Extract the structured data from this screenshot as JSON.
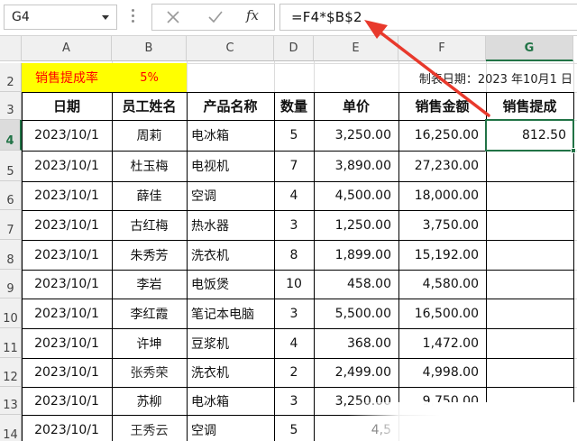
{
  "formula_bar": {
    "name_box": "G4",
    "formula": "=F4*$B$2",
    "fx_label": "fx"
  },
  "columns": [
    "A",
    "B",
    "C",
    "D",
    "E",
    "F",
    "G"
  ],
  "rows": [
    "2",
    "3",
    "4",
    "5",
    "6",
    "7",
    "8",
    "9",
    "10",
    "11",
    "12",
    "13",
    "14"
  ],
  "selected": {
    "column": "G",
    "row": "4"
  },
  "rate": {
    "label": "销售提成率",
    "value": "5%"
  },
  "report_date": "制表日期：2023 年10月1 日",
  "headers": [
    "日期",
    "员工姓名",
    "产品名称",
    "数量",
    "单价",
    "销售金额",
    "销售提成"
  ],
  "data_rows": [
    {
      "date": "2023/10/1",
      "name": "周莉",
      "product": "电冰箱",
      "qty": "5",
      "price": "3,250.00",
      "amount": "16,250.00",
      "commission": "812.50"
    },
    {
      "date": "2023/10/1",
      "name": "杜玉梅",
      "product": "电视机",
      "qty": "7",
      "price": "3,890.00",
      "amount": "27,230.00",
      "commission": ""
    },
    {
      "date": "2023/10/1",
      "name": "薛佳",
      "product": "空调",
      "qty": "4",
      "price": "4,500.00",
      "amount": "18,000.00",
      "commission": ""
    },
    {
      "date": "2023/10/1",
      "name": "古红梅",
      "product": "热水器",
      "qty": "3",
      "price": "1,250.00",
      "amount": "3,750.00",
      "commission": ""
    },
    {
      "date": "2023/10/1",
      "name": "朱秀芳",
      "product": "洗衣机",
      "qty": "8",
      "price": "1,899.00",
      "amount": "15,192.00",
      "commission": ""
    },
    {
      "date": "2023/10/1",
      "name": "李岩",
      "product": "电饭煲",
      "qty": "10",
      "price": "458.00",
      "amount": "4,580.00",
      "commission": ""
    },
    {
      "date": "2023/10/1",
      "name": "李红霞",
      "product": "笔记本电脑",
      "qty": "3",
      "price": "5,500.00",
      "amount": "16,500.00",
      "commission": ""
    },
    {
      "date": "2023/10/1",
      "name": "许坤",
      "product": "豆浆机",
      "qty": "4",
      "price": "368.00",
      "amount": "1,472.00",
      "commission": ""
    },
    {
      "date": "2023/10/1",
      "name": "张秀荣",
      "product": "洗衣机",
      "qty": "2",
      "price": "2,499.00",
      "amount": "4,998.00",
      "commission": ""
    },
    {
      "date": "2023/10/1",
      "name": "苏柳",
      "product": "电冰箱",
      "qty": "3",
      "price": "3,250.00",
      "amount": "9,750.00",
      "commission": ""
    },
    {
      "date": "2023/10/1",
      "name": "王秀云",
      "product": "空调",
      "qty": "5",
      "price": "4,5",
      "amount": "",
      "commission": ""
    }
  ],
  "colors": {
    "selection": "#217346",
    "rate_fill": "#ffff00",
    "rate_text": "#ff0000",
    "arrow": "#e8392c"
  }
}
